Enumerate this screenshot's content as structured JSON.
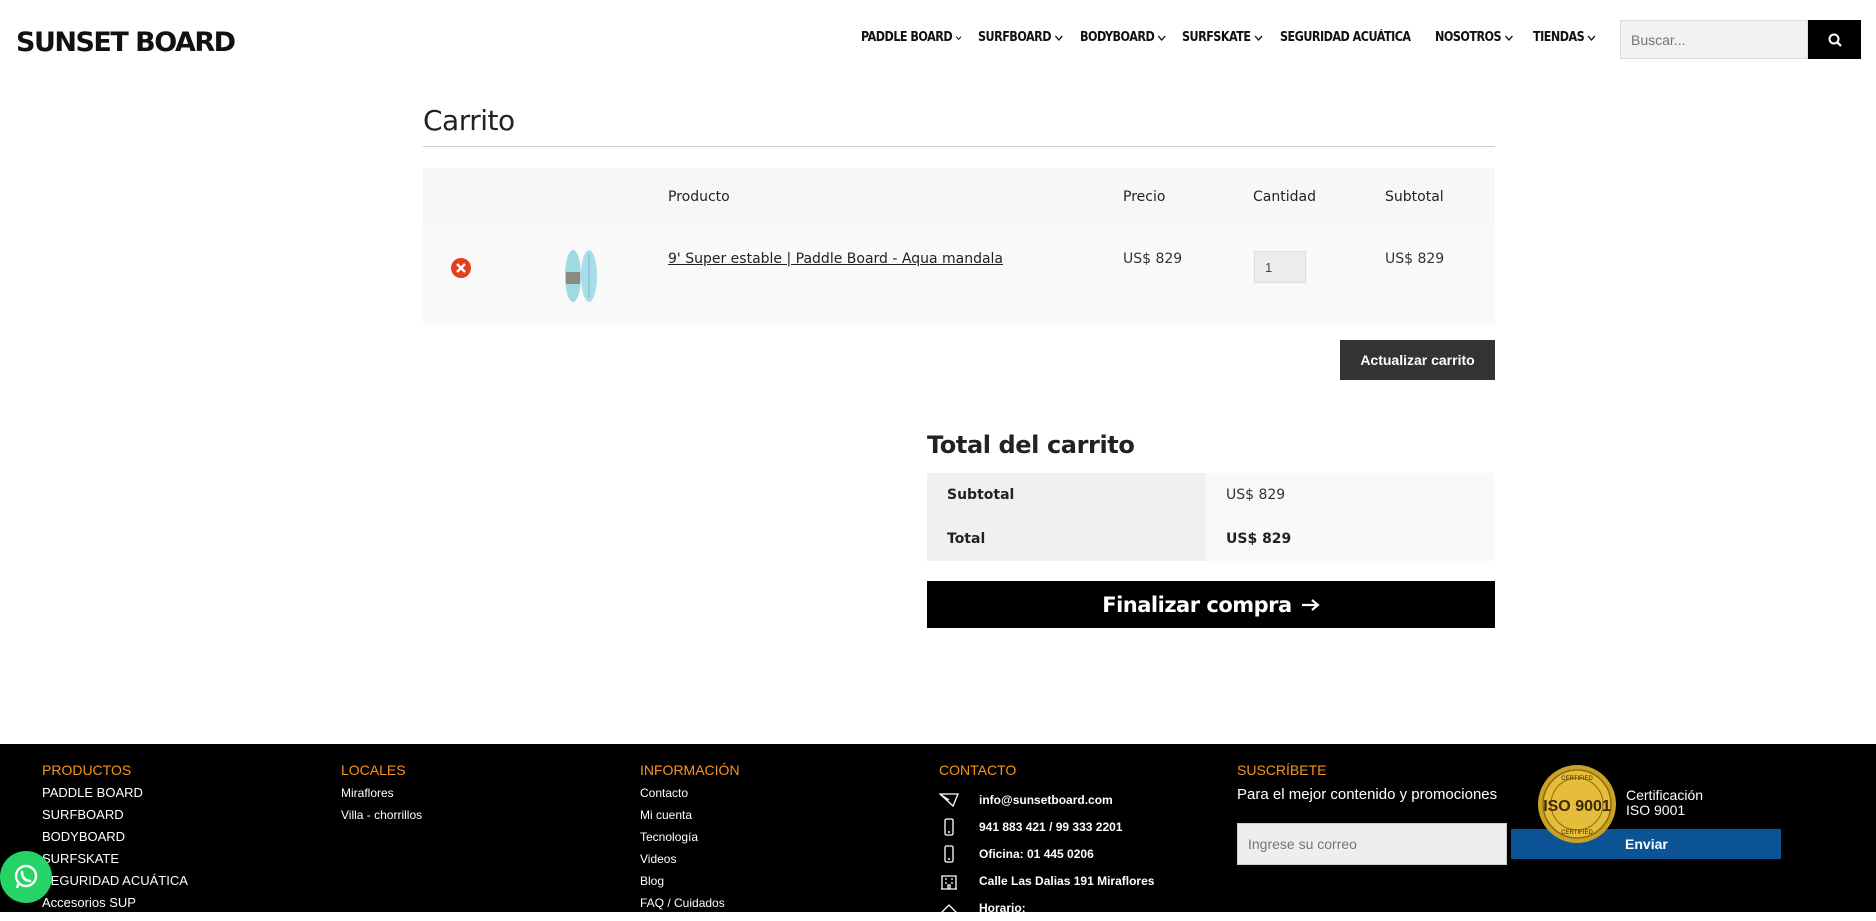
{
  "header": {
    "logo_text": "SUNSET BOARD",
    "nav": [
      "PADDLE BOARD",
      "SURFBOARD",
      "BODYBOARD",
      "SURFSKATE",
      "SEGURIDAD ACUÁTICA",
      "NOSOTROS",
      "TIENDAS"
    ],
    "search_placeholder": "Buscar..."
  },
  "cart": {
    "title": "Carrito",
    "columns": {
      "product": "Producto",
      "price": "Precio",
      "quantity": "Cantidad",
      "subtotal": "Subtotal"
    },
    "items": [
      {
        "name": "9' Super estable | Paddle Board - Aqua mandala",
        "price": "US$  829",
        "quantity": "1",
        "subtotal": "US$  829"
      }
    ],
    "update_label": "Actualizar carrito"
  },
  "totals": {
    "title": "Total del carrito",
    "subtotal_label": "Subtotal",
    "subtotal_value": "US$  829",
    "total_label": "Total",
    "total_value": "US$  829",
    "checkout_label": "Finalizar compra"
  },
  "footer": {
    "productos": {
      "heading": "PRODUCTOS",
      "links": [
        "PADDLE BOARD",
        "SURFBOARD",
        "BODYBOARD",
        "SURFSKATE",
        "SEGURIDAD ACUÁTICA",
        "Accesorios SUP"
      ]
    },
    "locales": {
      "heading": "LOCALES",
      "links": [
        "Miraflores",
        "Villa - chorrillos"
      ]
    },
    "informacion": {
      "heading": "INFORMACIÓN",
      "links": [
        "Contacto",
        "Mi cuenta",
        "Tecnología",
        "Videos",
        "Blog",
        "FAQ / Cuidados"
      ]
    },
    "contacto": {
      "heading": "CONTACTO",
      "email": "info@sunsetboard.com",
      "phones": "941 883 421 / 99 333 2201",
      "oficina": "Oficina: 01 445 0206",
      "address": "Calle Las Dalias 191 Miraflores",
      "horario": "Horario:"
    },
    "suscribete": {
      "heading": "SUSCRÍBETE",
      "text": "Para el mejor contenido y promociones",
      "input_placeholder": "Ingrese su correo",
      "button": "Enviar"
    },
    "iso": {
      "badge": "ISO 9001",
      "badge_ring": "CERTIFIED",
      "text_line1": "Certificación",
      "text_line2": "ISO 9001"
    }
  },
  "colors": {
    "accent_orange": "#f7941d",
    "footer_bg": "#000000",
    "remove_red": "#e2401c",
    "whatsapp": "#25d366"
  }
}
